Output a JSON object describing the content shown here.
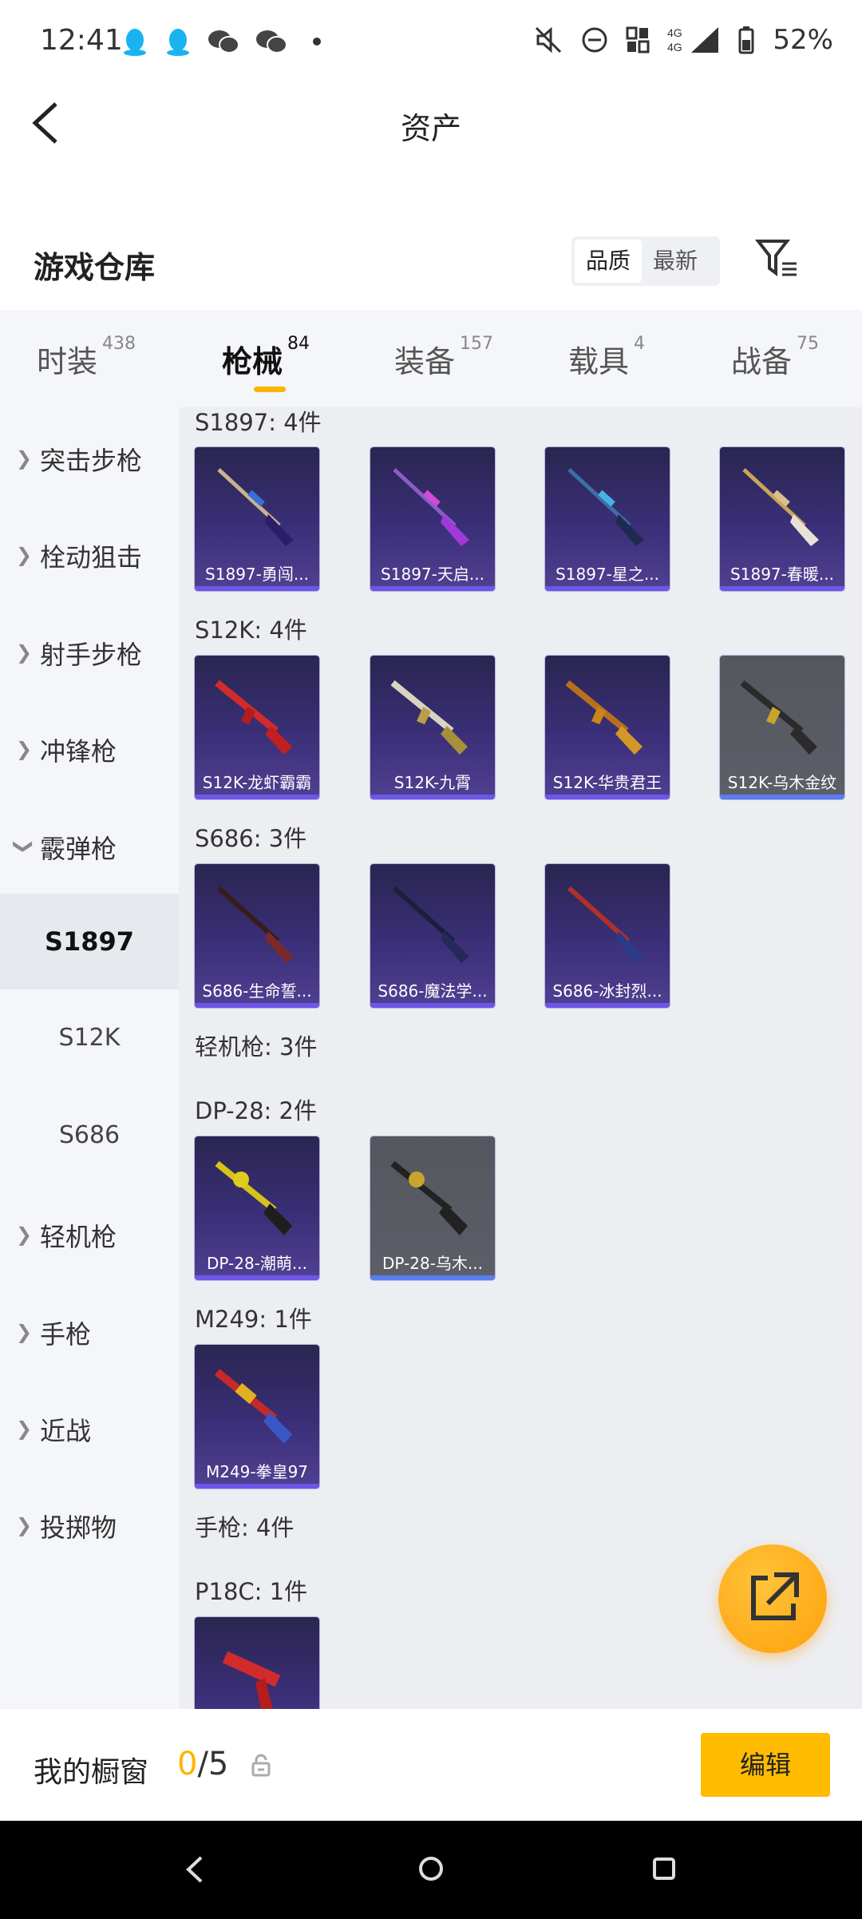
{
  "status_bar": {
    "time": "12:41",
    "battery": "52%"
  },
  "header": {
    "title": "资产"
  },
  "warehouse": {
    "title": "游戏仓库",
    "sort_options": [
      "品质",
      "最新"
    ],
    "sort_selected": "品质"
  },
  "tabs": [
    {
      "label": "时装",
      "count": "438"
    },
    {
      "label": "枪械",
      "count": "84"
    },
    {
      "label": "装备",
      "count": "157"
    },
    {
      "label": "载具",
      "count": "4"
    },
    {
      "label": "战备",
      "count": "75"
    }
  ],
  "sidebar": {
    "categories": [
      "突击步枪",
      "栓动狙击",
      "射手步枪",
      "冲锋枪",
      "霰弹枪"
    ],
    "sub_items": [
      "S1897",
      "S12K",
      "S686"
    ],
    "categories_after": [
      "轻机枪",
      "手枪",
      "近战",
      "投掷物"
    ]
  },
  "groups": [
    {
      "label": "S1897: 4件",
      "items": [
        "S1897-勇闯...",
        "S1897-天启...",
        "S1897-星之...",
        "S1897-春暖..."
      ]
    },
    {
      "label": "S12K: 4件",
      "items": [
        "S12K-龙虾霸霸",
        "S12K-九霄",
        "S12K-华贵君王",
        "S12K-乌木金纹"
      ]
    },
    {
      "label": "S686: 3件",
      "items": [
        "S686-生命誓...",
        "S686-魔法学...",
        "S686-冰封烈..."
      ]
    },
    {
      "label": "轻机枪: 3件"
    },
    {
      "label": "DP-28: 2件",
      "items": [
        "DP-28-潮萌...",
        "DP-28-乌木..."
      ]
    },
    {
      "label": "M249: 1件",
      "items": [
        "M249-拳皇97"
      ]
    },
    {
      "label": "手枪: 4件"
    },
    {
      "label": "P18C: 1件"
    }
  ],
  "showcase": {
    "label": "我的橱窗",
    "count_current": "0",
    "count_total": "/5",
    "edit_label": "编辑"
  },
  "colors": {
    "accent": "#ffbb00",
    "card_purple": "#3a2f78",
    "card_gray": "#5d5f68"
  }
}
